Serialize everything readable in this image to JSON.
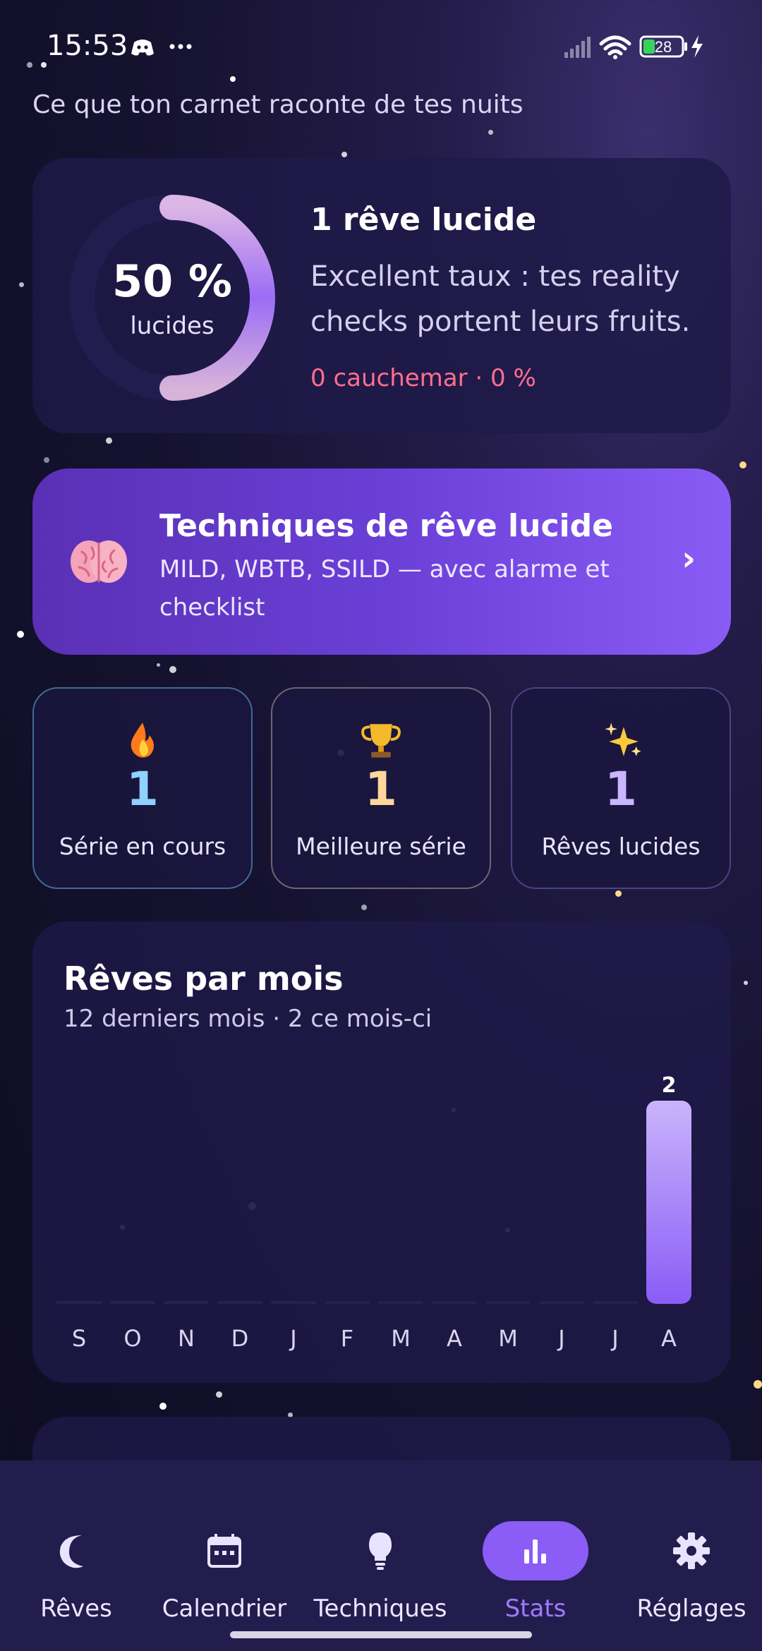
{
  "status_bar": {
    "time": "15:53",
    "battery": "28",
    "icons": [
      "discord-icon",
      "more-dots-icon",
      "signal-icon",
      "wifi-icon",
      "battery-icon",
      "charging-bolt-icon"
    ]
  },
  "header": {
    "subtitle": "Ce que ton carnet raconte de tes nuits"
  },
  "lucid_summary": {
    "percent_label": "50 %",
    "percent_value": 50,
    "caption": "lucides",
    "title": "1 rêve lucide",
    "description": "Excellent taux : tes reality checks portent leurs fruits.",
    "nightmares": "0 cauchemar · 0 %"
  },
  "techniques_banner": {
    "icon": "brain-icon",
    "title": "Techniques de rêve lucide",
    "subtitle": "MILD, WBTB, SSILD — avec alarme et checklist",
    "chevron": "›"
  },
  "stats": [
    {
      "icon": "fire-icon",
      "value": "1",
      "label": "Série en cours",
      "color": "#8fd1ff",
      "border": "#3f6b94"
    },
    {
      "icon": "trophy-icon",
      "value": "1",
      "label": "Meilleure série",
      "color": "#ffd79a",
      "border": "#6f6470"
    },
    {
      "icon": "sparkles-icon",
      "value": "1",
      "label": "Rêves lucides",
      "color": "#c9b6ff",
      "border": "#4a4283"
    }
  ],
  "monthly_chart": {
    "title": "Rêves par mois",
    "subtitle": "12 derniers mois · 2 ce mois-ci"
  },
  "chart_data": {
    "type": "bar",
    "categories": [
      "S",
      "O",
      "N",
      "D",
      "J",
      "F",
      "M",
      "A",
      "M",
      "J",
      "J",
      "A"
    ],
    "values": [
      0,
      0,
      0,
      0,
      0,
      0,
      0,
      0,
      0,
      0,
      0,
      2
    ],
    "data_labels": [
      "",
      "",
      "",
      "",
      "",
      "",
      "",
      "",
      "",
      "",
      "",
      "2"
    ],
    "title": "Rêves par mois",
    "ylim": [
      0,
      2
    ],
    "grid": false,
    "bar_color": "#9b7bf7"
  },
  "bottom_nav": {
    "items": [
      {
        "label": "Rêves",
        "icon": "moon-icon",
        "active": false
      },
      {
        "label": "Calendrier",
        "icon": "calendar-icon",
        "active": false
      },
      {
        "label": "Techniques",
        "icon": "lightbulb-icon",
        "active": false
      },
      {
        "label": "Stats",
        "icon": "bar-chart-icon",
        "active": true
      },
      {
        "label": "Réglages",
        "icon": "gear-icon",
        "active": false
      }
    ]
  },
  "colors": {
    "accent": "#8b5cf6",
    "nightmare": "#ff6f8f",
    "background": "#15122f"
  }
}
